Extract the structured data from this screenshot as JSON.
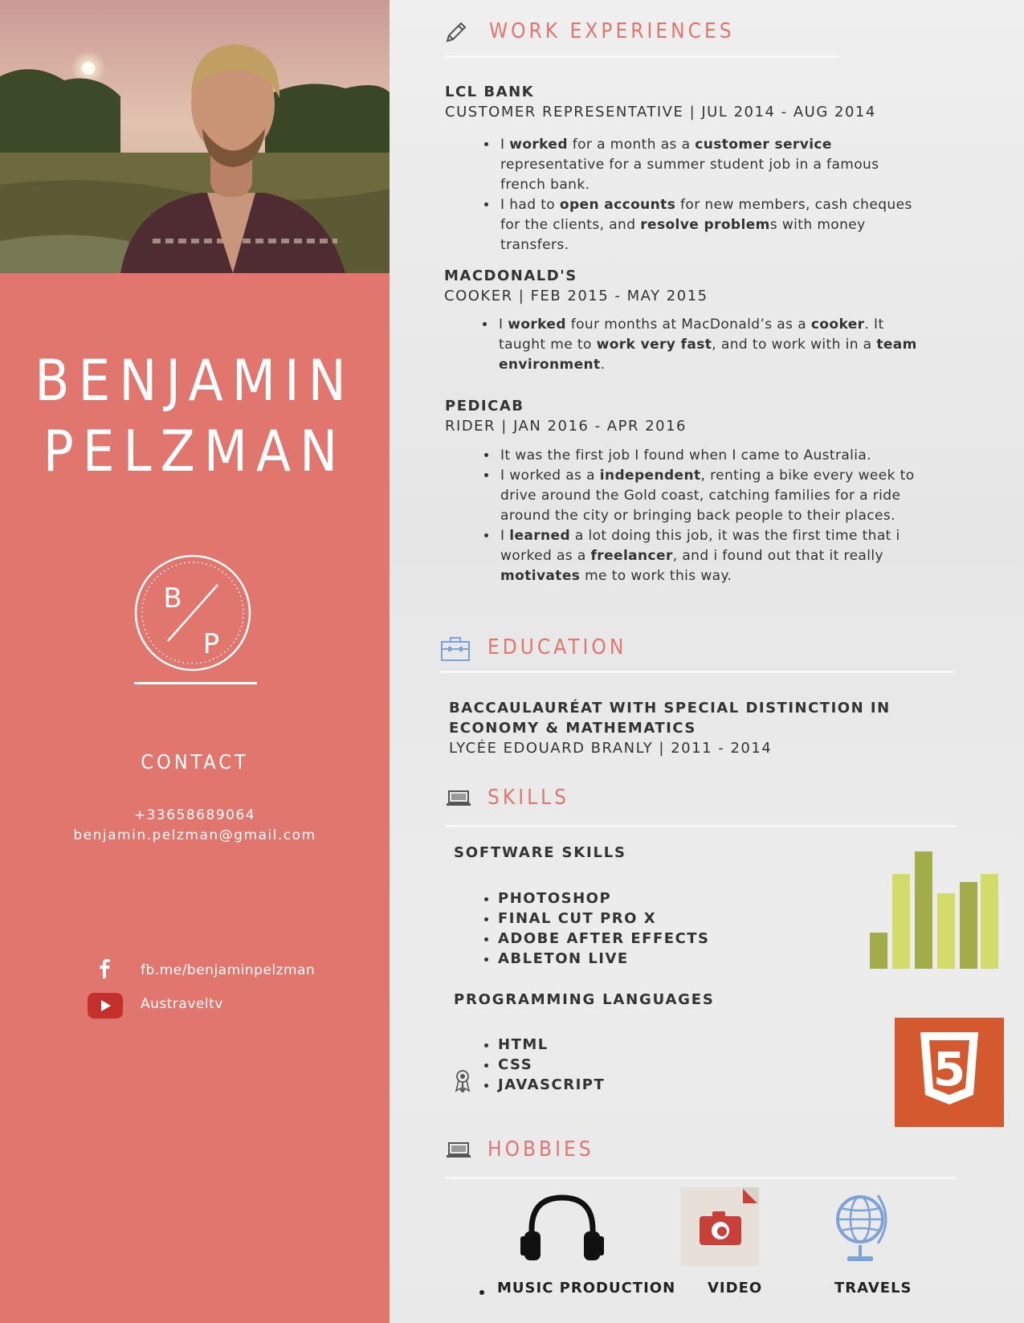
{
  "profile": {
    "first_name": "BENJAMIN",
    "last_name": "PELZMAN",
    "monogram_top": "B",
    "monogram_bottom": "P"
  },
  "contact": {
    "title": "CONTACT",
    "phone": "+33658689064",
    "email": "benjamin.pelzman@gmail.com",
    "facebook": "fb.me/benjaminpelzman",
    "youtube": "Austraveltv"
  },
  "work": {
    "heading": "WORK EXPERIENCES",
    "jobs": [
      {
        "company": "LCL BANK",
        "role": "CUSTOMER REPRESENTATIVE  | JUL 2014 - AUG 2014",
        "bullets_html": [
          "I <b>worked</b> for a month as a <b>customer service</b> representative for a summer student job in a famous french bank.",
          " I had to <b>open accounts</b> for new members, cash cheques for the clients, and <b>resolve problem</b>s with money transfers."
        ]
      },
      {
        "company": "MACDONALD'S",
        "role": "COOKER |  FEB 2015 - MAY 2015",
        "bullets_html": [
          "I <b>worked</b> four months at MacDonald’s as a <b>cooker</b>. It taught me to <b>work very fast</b>, and to work with in a <b>team environment</b>."
        ]
      },
      {
        "company": "PEDICAB",
        "role": "RIDER |  JAN 2016 - APR 2016",
        "bullets_html": [
          "It was the first job I found when I came to Australia.",
          " I worked as a <b>independent</b>, renting a bike every week to drive around the Gold coast, catching families for a ride around the city or bringing back people to their places.",
          "I <b>learned</b> a lot doing this job, it was the first time that i worked as a <b>freelancer</b>, and i found out that it really <b>motivates</b> me to work this way."
        ]
      }
    ]
  },
  "education": {
    "heading": "EDUCATION",
    "degree_line1": "BACCAULAURÉAT WITH SPECIAL DISTINCTION IN",
    "degree_line2": "ECONOMY & MATHEMATICS",
    "school": "LYCÉE EDOUARD BRANLY |  2011 - 2014"
  },
  "skills": {
    "heading": "SKILLS",
    "software_title": "SOFTWARE SKILLS",
    "software": [
      "PHOTOSHOP",
      "FINAL CUT PRO X",
      "ADOBE AFTER EFFECTS",
      "ABLETON LIVE"
    ],
    "programming_title": "PROGRAMMING LANGUAGES",
    "programming": [
      "HTML",
      "CSS",
      "JAVASCRIPT"
    ],
    "html5_badge": "5"
  },
  "hobbies": {
    "heading": "HOBBIES",
    "items": [
      "MUSIC PRODUCTION",
      "VIDEO",
      "TRAVELS"
    ]
  },
  "colors": {
    "accent": "#e0766e",
    "html5": "#d4592f",
    "bar_light": "#d3dc6b",
    "bar_dark": "#a2ad4a",
    "globe": "#7da2d8"
  }
}
